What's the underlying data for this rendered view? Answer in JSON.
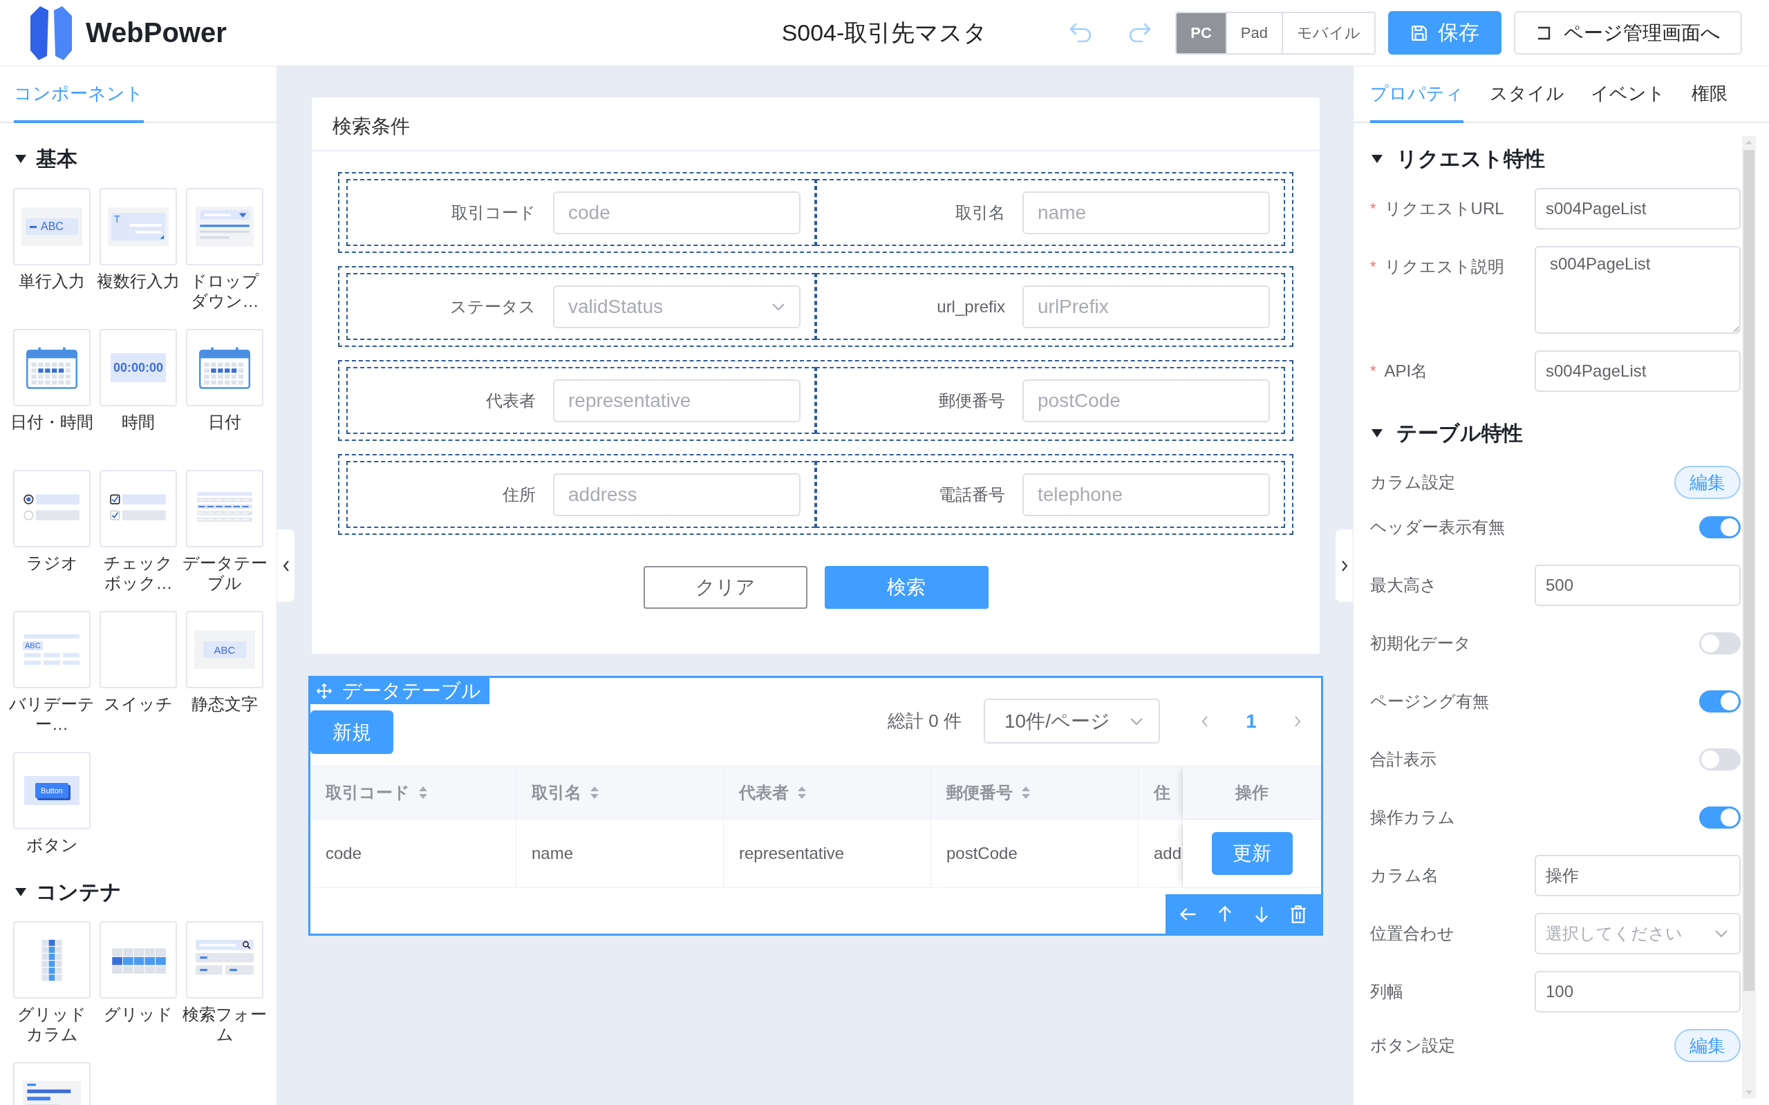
{
  "header": {
    "logo": "WebPower",
    "title": "S004-取引先マスタ",
    "devices": [
      {
        "label": "PC",
        "selected": true
      },
      {
        "label": "Pad",
        "selected": false
      },
      {
        "label": "モバイル",
        "selected": false
      }
    ],
    "save": "保存",
    "back": "ページ管理画面へ"
  },
  "component_panel": {
    "tabs": [
      {
        "label": "コンポーネント",
        "selected": true
      }
    ],
    "groups": [
      {
        "title": "基本",
        "expanded": true,
        "items": [
          {
            "kind": "text-input",
            "label": "単行入力",
            "preview_text": "ABC"
          },
          {
            "kind": "textarea",
            "label": "複数行入力",
            "preview_text": "T"
          },
          {
            "kind": "dropdown",
            "label": "ドロップダウン…"
          },
          {
            "kind": "datetime",
            "label": "日付・時間"
          },
          {
            "kind": "time",
            "label": "時間",
            "preview_text": "00:00:00"
          },
          {
            "kind": "date",
            "label": "日付"
          },
          {
            "kind": "radio",
            "label": "ラジオ"
          },
          {
            "kind": "checkbox",
            "label": "チェックボック…"
          },
          {
            "kind": "datatable",
            "label": "データテーブル"
          },
          {
            "kind": "validation",
            "label": "バリデーテー…",
            "preview_text": "ABC"
          },
          {
            "kind": "switch",
            "label": "スイッチ"
          },
          {
            "kind": "static-text",
            "label": "静态文字",
            "preview_text": "ABC"
          },
          {
            "kind": "button",
            "label": "ボタン",
            "preview_text": "Button"
          }
        ]
      },
      {
        "title": "コンテナ",
        "expanded": true,
        "items": [
          {
            "kind": "grid-column",
            "label": "グリッドカラム"
          },
          {
            "kind": "grid",
            "label": "グリッド"
          },
          {
            "kind": "search-form",
            "label": "検索フォーム"
          },
          {
            "kind": "list"
          }
        ]
      }
    ]
  },
  "canvas": {
    "search_form": {
      "title": "検索条件",
      "rows": [
        [
          {
            "label": "取引コード",
            "kind": "input",
            "placeholder": "code"
          },
          {
            "label": "取引名",
            "kind": "input",
            "placeholder": "name"
          }
        ],
        [
          {
            "label": "ステータス",
            "kind": "select",
            "placeholder": "validStatus"
          },
          {
            "label": "url_prefix",
            "kind": "input",
            "placeholder": "urlPrefix"
          }
        ],
        [
          {
            "label": "代表者",
            "kind": "input",
            "placeholder": "representative"
          },
          {
            "label": "郵便番号",
            "kind": "input",
            "placeholder": "postCode"
          }
        ],
        [
          {
            "label": "住所",
            "kind": "input",
            "placeholder": "address"
          },
          {
            "label": "電話番号",
            "kind": "input",
            "placeholder": "telephone"
          }
        ]
      ],
      "buttons": [
        {
          "label": "クリア",
          "kind": "default"
        },
        {
          "label": "検索",
          "kind": "primary"
        }
      ]
    },
    "data_table": {
      "tag": "データテーブル",
      "new_button": "新規",
      "total": "総計 0 件",
      "page_size": "10件/ページ",
      "pages": [
        {
          "label": "1",
          "selected": true
        }
      ],
      "columns": [
        {
          "label": "取引コード",
          "sort_icon": true
        },
        {
          "label": "取引名",
          "sort_icon": true
        },
        {
          "label": "代表者",
          "sort_icon": true
        },
        {
          "label": "郵便番号",
          "sort_icon": true
        },
        {
          "label": "住",
          "sort_icon": false
        }
      ],
      "action_column": "操作",
      "rows": [
        {
          "cells": [
            "code",
            "name",
            "representative",
            "postCode",
            "add"
          ],
          "action": "更新"
        }
      ]
    }
  },
  "property_panel": {
    "tabs": [
      {
        "label": "プロパティ",
        "selected": true
      },
      {
        "label": "スタイル",
        "selected": false
      },
      {
        "label": "イベント",
        "selected": false
      },
      {
        "label": "権限",
        "selected": false
      }
    ],
    "sections": [
      {
        "title": "リクエスト特性",
        "expanded": true,
        "fields": [
          {
            "kind": "input",
            "mark": "*",
            "label": "リクエストURL",
            "value": "s004PageList"
          },
          {
            "kind": "textarea",
            "mark": "*",
            "label": "リクエスト説明",
            "value": "s004PageList"
          },
          {
            "kind": "input",
            "mark": "*",
            "label": "API名",
            "value": "s004PageList"
          }
        ]
      },
      {
        "title": "テーブル特性",
        "expanded": true,
        "fields": [
          {
            "kind": "button",
            "label": "カラム設定",
            "button": "編集"
          },
          {
            "kind": "toggle",
            "label": "ヘッダー表示有無",
            "on": true
          },
          {
            "kind": "input",
            "label": "最大高さ",
            "value": "500"
          },
          {
            "kind": "toggle",
            "label": "初期化データ",
            "on": false
          },
          {
            "kind": "toggle",
            "label": "ページング有無",
            "on": true
          },
          {
            "kind": "toggle",
            "label": "合計表示",
            "on": false
          },
          {
            "kind": "toggle",
            "label": "操作カラム",
            "on": true
          },
          {
            "kind": "input",
            "label": "カラム名",
            "value": "操作"
          },
          {
            "kind": "select",
            "label": "位置合わせ",
            "placeholder": "選択してください"
          },
          {
            "kind": "input",
            "label": "列幅",
            "value": "100"
          },
          {
            "kind": "button",
            "label": "ボタン設定",
            "button": "編集"
          }
        ]
      }
    ]
  }
}
